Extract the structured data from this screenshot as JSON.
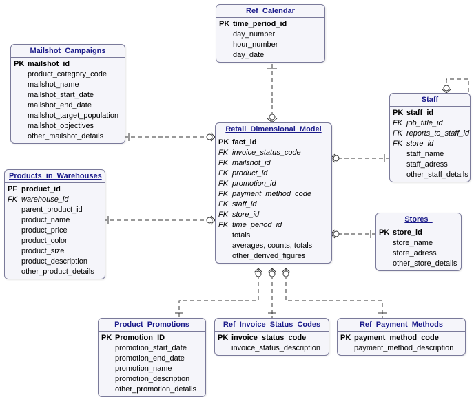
{
  "entities": {
    "ref_calendar": {
      "title": "Ref_Calendar",
      "attrs": [
        {
          "key": "PK",
          "name": "time_period_id",
          "pk": true
        },
        {
          "key": "",
          "name": "day_number"
        },
        {
          "key": "",
          "name": "hour_number"
        },
        {
          "key": "",
          "name": "day_date"
        }
      ]
    },
    "mailshot_campaigns": {
      "title": "Mailshot_Campaigns",
      "attrs": [
        {
          "key": "PK",
          "name": "mailshot_id",
          "pk": true
        },
        {
          "key": "",
          "name": "product_category_code"
        },
        {
          "key": "",
          "name": "mailshot_name"
        },
        {
          "key": "",
          "name": "mailshot_start_date"
        },
        {
          "key": "",
          "name": "mailshot_end_date"
        },
        {
          "key": "",
          "name": "mailshot_target_population"
        },
        {
          "key": "",
          "name": "mailshot_objectives"
        },
        {
          "key": "",
          "name": "other_mailshot_details"
        }
      ]
    },
    "products_in_warehouses": {
      "title": "Products_in_Warehouses",
      "attrs": [
        {
          "key": "PF",
          "name": "product_id",
          "pk": true
        },
        {
          "key": "FK",
          "name": "warehouse_id",
          "fk": true
        },
        {
          "key": "",
          "name": "parent_product_id"
        },
        {
          "key": "",
          "name": "product_name"
        },
        {
          "key": "",
          "name": "product_price"
        },
        {
          "key": "",
          "name": "product_color"
        },
        {
          "key": "",
          "name": "product_size"
        },
        {
          "key": "",
          "name": "product_description"
        },
        {
          "key": "",
          "name": "other_product_details"
        }
      ]
    },
    "retail_dimensional_model": {
      "title": "Retail_Dimensional_Model",
      "attrs": [
        {
          "key": "PK",
          "name": "fact_id",
          "pk": true
        },
        {
          "key": "FK",
          "name": "invoice_status_code",
          "fk": true
        },
        {
          "key": "FK",
          "name": "mailshot_id",
          "fk": true
        },
        {
          "key": "FK",
          "name": "product_id",
          "fk": true
        },
        {
          "key": "FK",
          "name": "promotion_id",
          "fk": true
        },
        {
          "key": "FK",
          "name": "payment_method_code",
          "fk": true
        },
        {
          "key": "FK",
          "name": "staff_id",
          "fk": true
        },
        {
          "key": "FK",
          "name": "store_id",
          "fk": true
        },
        {
          "key": "FK",
          "name": "time_period_id",
          "fk": true
        },
        {
          "key": "",
          "name": "totals"
        },
        {
          "key": "",
          "name": "averages, counts, totals"
        },
        {
          "key": "",
          "name": "other_derived_figures"
        }
      ]
    },
    "staff": {
      "title": "Staff",
      "attrs": [
        {
          "key": "PK",
          "name": "staff_id",
          "pk": true
        },
        {
          "key": "FK",
          "name": "job_title_id",
          "fk": true
        },
        {
          "key": "FK",
          "name": "reports_to_staff_id",
          "fk": true
        },
        {
          "key": "FK",
          "name": "store_id",
          "fk": true
        },
        {
          "key": "",
          "name": "staff_name"
        },
        {
          "key": "",
          "name": "staff_adress"
        },
        {
          "key": "",
          "name": "other_staff_details"
        }
      ]
    },
    "stores": {
      "title": "Stores_",
      "attrs": [
        {
          "key": "PK",
          "name": "store_id",
          "pk": true
        },
        {
          "key": "",
          "name": "store_name"
        },
        {
          "key": "",
          "name": "store_adress"
        },
        {
          "key": "",
          "name": "other_store_details"
        }
      ]
    },
    "product_promotions": {
      "title": "Product_Promotions",
      "attrs": [
        {
          "key": "PK",
          "name": "Promotion_ID",
          "pk": true
        },
        {
          "key": "",
          "name": "promotion_start_date"
        },
        {
          "key": "",
          "name": "promotion_end_date"
        },
        {
          "key": "",
          "name": "promotion_name"
        },
        {
          "key": "",
          "name": "promotion_description"
        },
        {
          "key": "",
          "name": "other_promotion_details"
        }
      ]
    },
    "ref_invoice_status_codes": {
      "title": "Ref_Invoice_Status_Codes",
      "attrs": [
        {
          "key": "PK",
          "name": "invoice_status_code",
          "pk": true
        },
        {
          "key": "",
          "name": "invoice_status_description"
        }
      ]
    },
    "ref_payment_methods": {
      "title": "Ref_Payment_Methods",
      "attrs": [
        {
          "key": "PK",
          "name": "payment_method_code",
          "pk": true
        },
        {
          "key": "",
          "name": "payment_method_description"
        }
      ]
    }
  }
}
